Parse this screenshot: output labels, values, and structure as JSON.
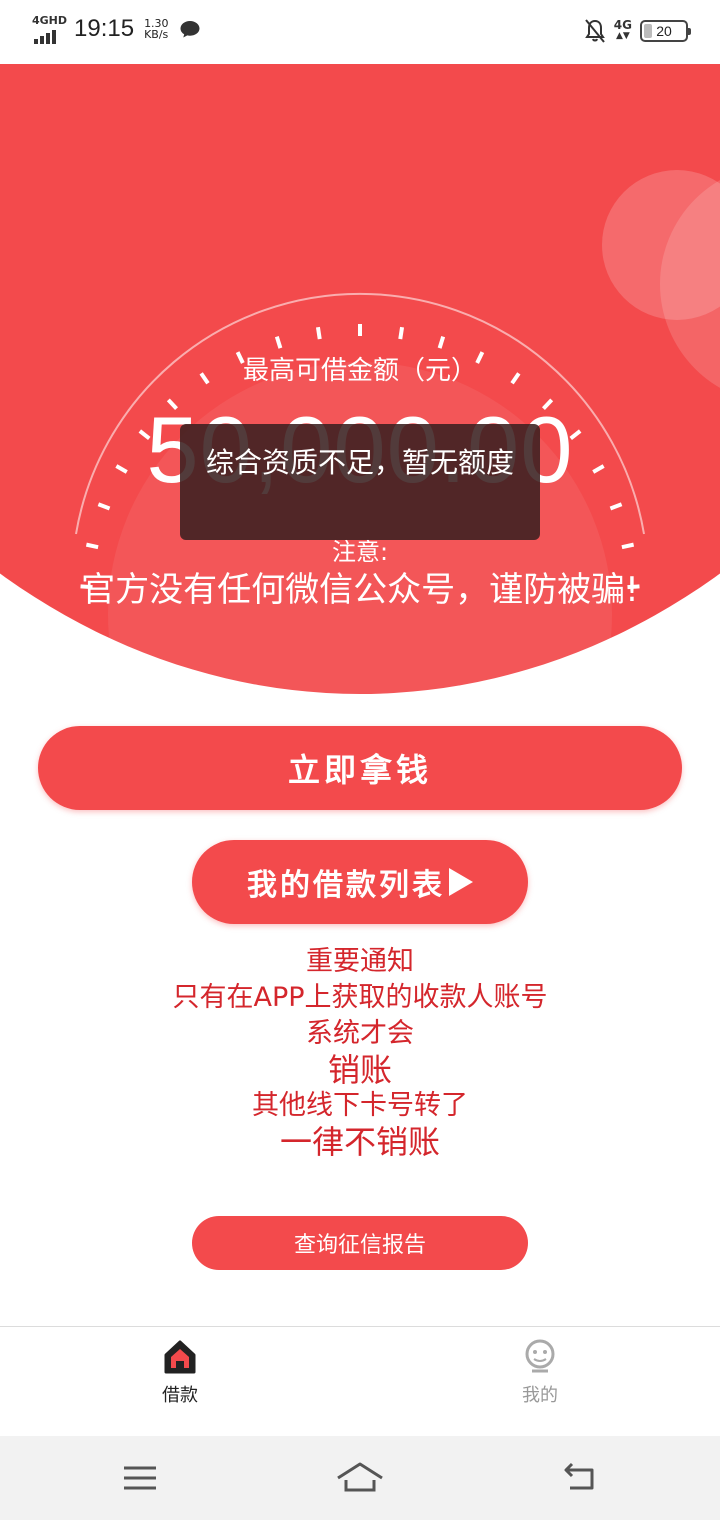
{
  "status_bar": {
    "network_tag": "4GHD",
    "time": "19:15",
    "speed_value": "1.30",
    "speed_unit": "KB/s",
    "net_type": "4G",
    "battery": "20"
  },
  "hero": {
    "amount_caption": "最高可借金额（元）",
    "amount": "50,000.00",
    "note_title": "注意:",
    "note_text": "官方没有任何微信公众号，谨防被骗!"
  },
  "toast": {
    "message": "综合资质不足，暂无额度"
  },
  "buttons": {
    "get_money": "立即拿钱",
    "loan_list": "我的借款列表",
    "credit_report": "查询征信报告"
  },
  "notice": {
    "title": "重要通知",
    "line1": "只有在APP上获取的收款人账号",
    "line2": "系统才会",
    "line3": "销账",
    "line4": "其他线下卡号转了",
    "line5": "一律不销账"
  },
  "tabbar": {
    "tabs": [
      {
        "label": "借款",
        "icon": "home-icon",
        "active": true
      },
      {
        "label": "我的",
        "icon": "profile-icon",
        "active": false
      }
    ]
  },
  "colors": {
    "brand_red": "#f34a4c",
    "notice_red": "#d4262c"
  }
}
